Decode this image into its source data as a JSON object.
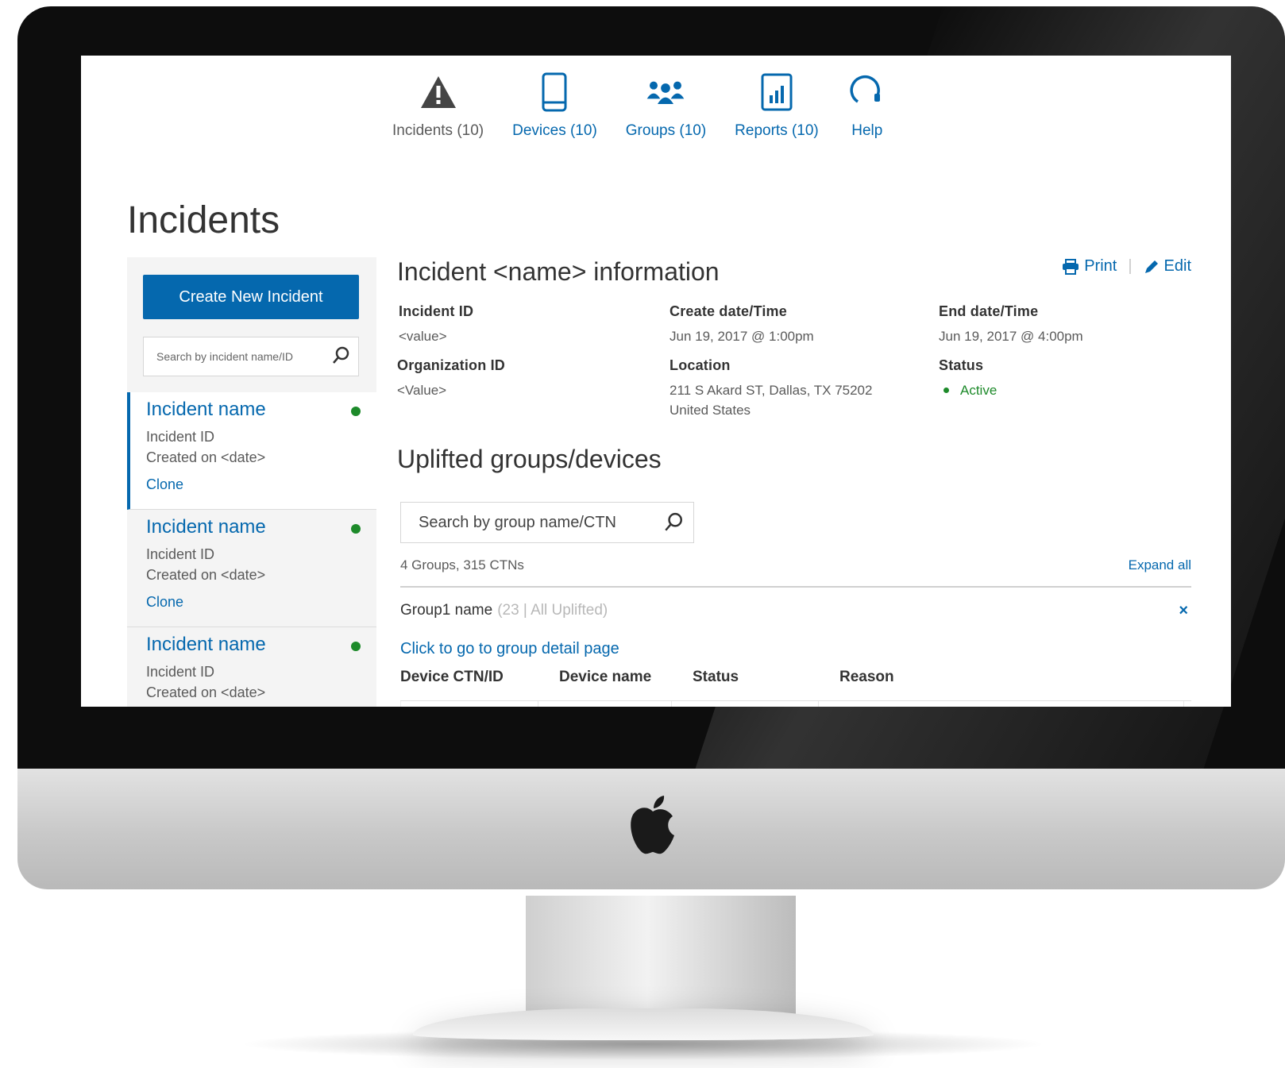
{
  "nav": {
    "items": [
      {
        "label": "Incidents (10)",
        "icon": "warning-triangle-icon",
        "active": false
      },
      {
        "label": "Devices (10)",
        "icon": "mobile-device-icon",
        "active": true
      },
      {
        "label": "Groups (10)",
        "icon": "group-people-icon",
        "active": true
      },
      {
        "label": "Reports (10)",
        "icon": "bar-chart-report-icon",
        "active": true
      },
      {
        "label": "Help",
        "icon": "headset-help-icon",
        "active": true
      }
    ]
  },
  "page": {
    "title": "Incidents"
  },
  "sidebar": {
    "create_button": "Create New Incident",
    "search_placeholder": "Search by incident name/ID",
    "incidents": [
      {
        "name": "Incident name",
        "id": "Incident ID",
        "created": "Created on <date>",
        "clone": "Clone"
      },
      {
        "name": "Incident name",
        "id": "Incident ID",
        "created": "Created on <date>",
        "clone": "Clone"
      },
      {
        "name": "Incident name",
        "id": "Incident ID",
        "created": "Created on <date>"
      }
    ]
  },
  "detail": {
    "title": "Incident <name> information",
    "print": "Print",
    "edit": "Edit",
    "fields": {
      "incident_id": {
        "label": "Incident ID",
        "value": "<value>"
      },
      "create_dt": {
        "label": "Create date/Time",
        "value": "Jun 19, 2017 @ 1:00pm"
      },
      "end_dt": {
        "label": "End date/Time",
        "value": "Jun 19, 2017 @ 4:00pm"
      },
      "org_id": {
        "label": "Organization ID",
        "value": "<Value>"
      },
      "location": {
        "label": "Location",
        "line1": "211 S Akard ST, Dallas, TX 75202",
        "line2": "United States"
      },
      "status": {
        "label": "Status",
        "value": "Active"
      }
    }
  },
  "uplifted": {
    "title": "Uplifted groups/devices",
    "search_placeholder": "Search by group name/CTN",
    "summary": "4 Groups, 315 CTNs",
    "expand_all": "Expand all",
    "group": {
      "name": "Group1 name",
      "meta": "(23 | All Uplifted)",
      "close": "×"
    },
    "group_link": "Click to go to group detail page",
    "columns": [
      "Device CTN/ID",
      "Device name",
      "Status",
      "Reason"
    ]
  },
  "colors": {
    "accent": "#0568ae",
    "status_active": "#1d8a2a"
  }
}
